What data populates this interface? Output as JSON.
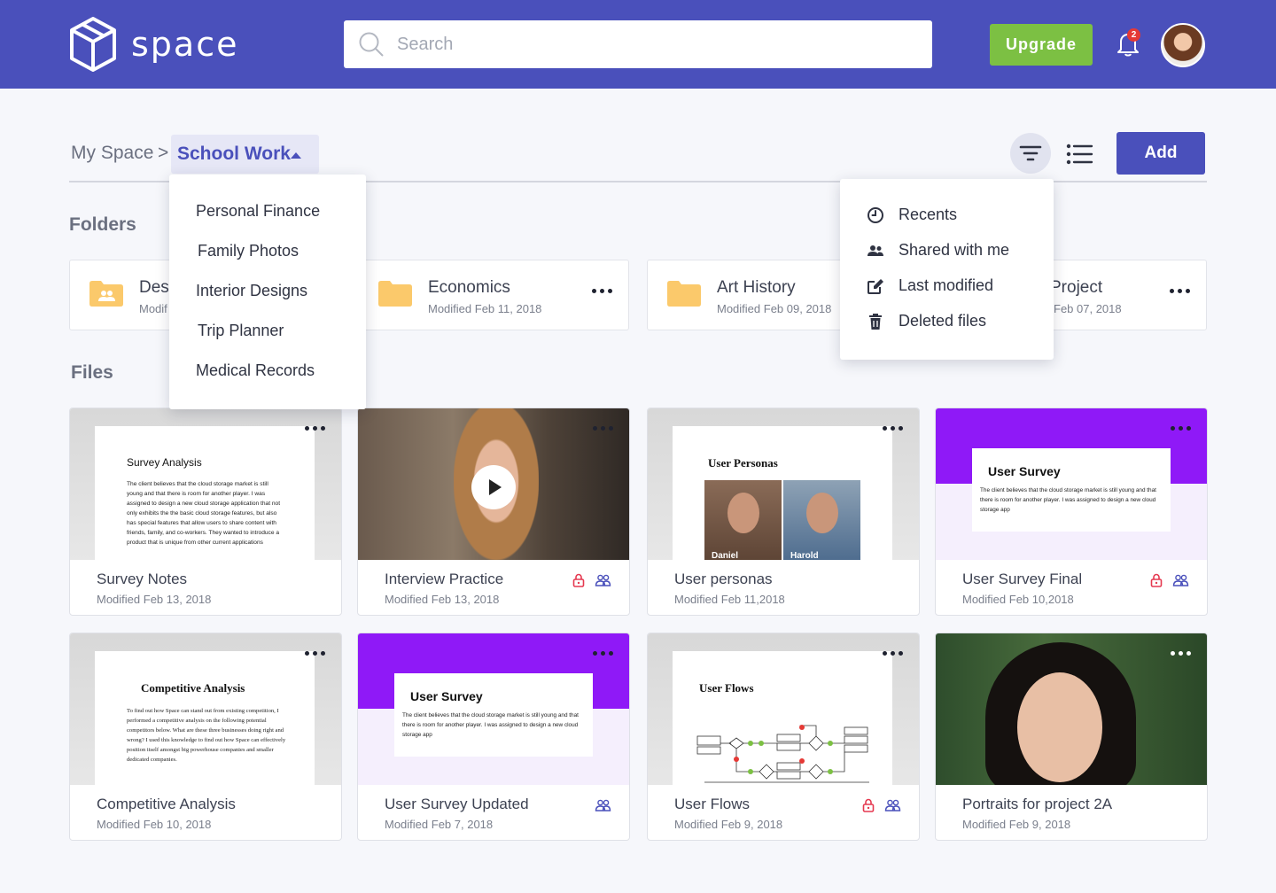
{
  "app": {
    "name": "space"
  },
  "header": {
    "search_placeholder": "Search",
    "upgrade_label": "Upgrade",
    "notification_count": "2"
  },
  "breadcrumb": {
    "root": "My Space",
    "separator": ">",
    "current": "School Work"
  },
  "toolbar": {
    "add_label": "Add"
  },
  "breadcrumb_menu": {
    "items": [
      "Personal Finance",
      "Family Photos",
      "Interior Designs",
      "Trip Planner",
      "Medical Records"
    ]
  },
  "filter_menu": {
    "items": [
      {
        "label": "Recents",
        "icon": "clock-icon"
      },
      {
        "label": "Shared with me",
        "icon": "people-icon"
      },
      {
        "label": "Last modified",
        "icon": "edit-icon"
      },
      {
        "label": "Deleted files",
        "icon": "trash-icon"
      }
    ]
  },
  "sections": {
    "folders": "Folders",
    "files": "Files"
  },
  "folders": [
    {
      "name": "Des",
      "modified": "Modif",
      "shared": true
    },
    {
      "name": "Economics",
      "modified": "Modified Feb 11, 2018"
    },
    {
      "name": "Art History",
      "modified": "Modified Feb 09, 2018"
    },
    {
      "name": "Project",
      "modified": "Feb 07, 2018"
    }
  ],
  "files": [
    {
      "name": "Survey Notes",
      "modified": "Modified Feb 13, 2018",
      "thumb_title": "Survey Analysis",
      "thumb_text": "The client believes that the cloud storage market is still young and that there is room for another player. I was assigned to design a new cloud storage application that not only exhibits the the basic cloud storage features, but also has special features that allow users to share content with friends, family, and co-workers. They wanted to introduce a product that is unique from other current applications"
    },
    {
      "name": "Interview Practice",
      "modified": "Modified Feb 13, 2018",
      "locked": true,
      "shared": true
    },
    {
      "name": "User personas",
      "modified": "Modified Feb 11,2018",
      "thumb_title": "User Personas",
      "persona_1": "Daniel",
      "persona_2": "Harold"
    },
    {
      "name": "User Survey Final",
      "modified": "Modified Feb 10,2018",
      "locked": true,
      "shared": true,
      "thumb_title": "User Survey",
      "thumb_text": "The client believes that the cloud storage market is still young and that there is room for another player. I was assigned to design a new cloud storage app"
    },
    {
      "name": "Competitive Analysis",
      "modified": "Modified Feb 10, 2018",
      "thumb_title": "Competitive Analysis",
      "thumb_text": "To find out how Space can stand out from existing competition, I performed a competitive analysis on the following potential competitors below. What are these three businesses doing right and wrong? I used this knowledge to find out how Space can effectively position itself amongst big powerhouse companies and smaller dedicated companies."
    },
    {
      "name": "User Survey Updated",
      "modified": "Modified Feb 7, 2018",
      "shared": true,
      "thumb_title": "User Survey",
      "thumb_text": "The client believes that the cloud storage market is still young and that there is room for another player. I was assigned to design a new cloud storage app"
    },
    {
      "name": "User Flows",
      "modified": "Modified Feb 9, 2018",
      "locked": true,
      "shared": true,
      "thumb_title": "User Flows"
    },
    {
      "name": "Portraits for project 2A",
      "modified": "Modified Feb 9, 2018"
    }
  ],
  "colors": {
    "brand": "#4a50bb",
    "upgrade": "#7cc043",
    "survey_purple": "#8f19f7",
    "lock_red": "#e53950"
  }
}
